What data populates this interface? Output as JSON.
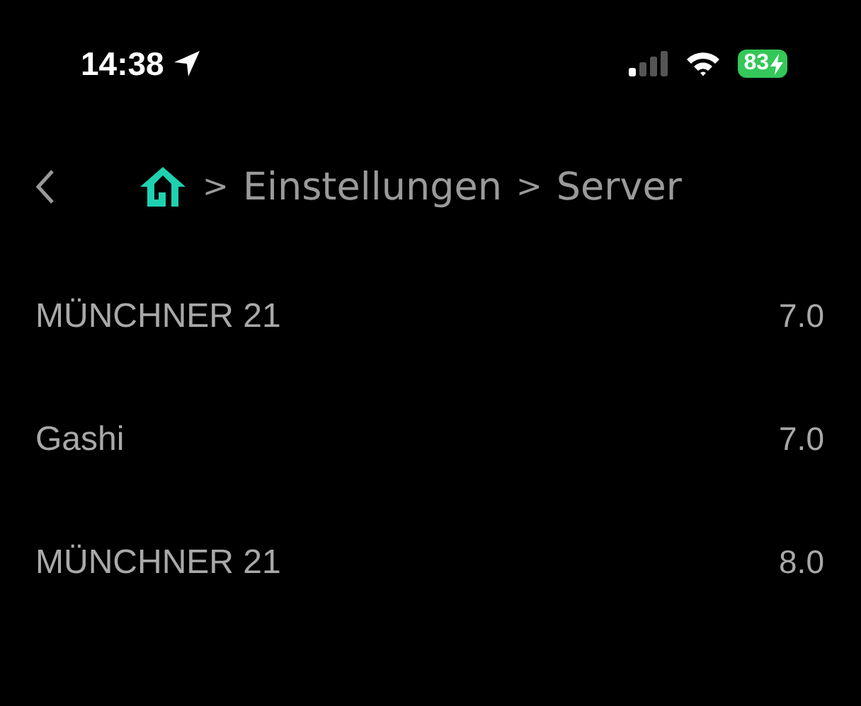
{
  "status_bar": {
    "time": "14:38",
    "location_active": true,
    "battery": {
      "percent": "83",
      "charging": true
    }
  },
  "breadcrumb": [
    {
      "separator": ">",
      "label": "Einstellungen"
    },
    {
      "separator": ">",
      "label": "Server"
    }
  ],
  "servers": [
    {
      "name": "MÜNCHNER 21",
      "version": "7.0"
    },
    {
      "name": "Gashi",
      "version": "7.0"
    },
    {
      "name": "MÜNCHNER 21",
      "version": "8.0"
    }
  ]
}
